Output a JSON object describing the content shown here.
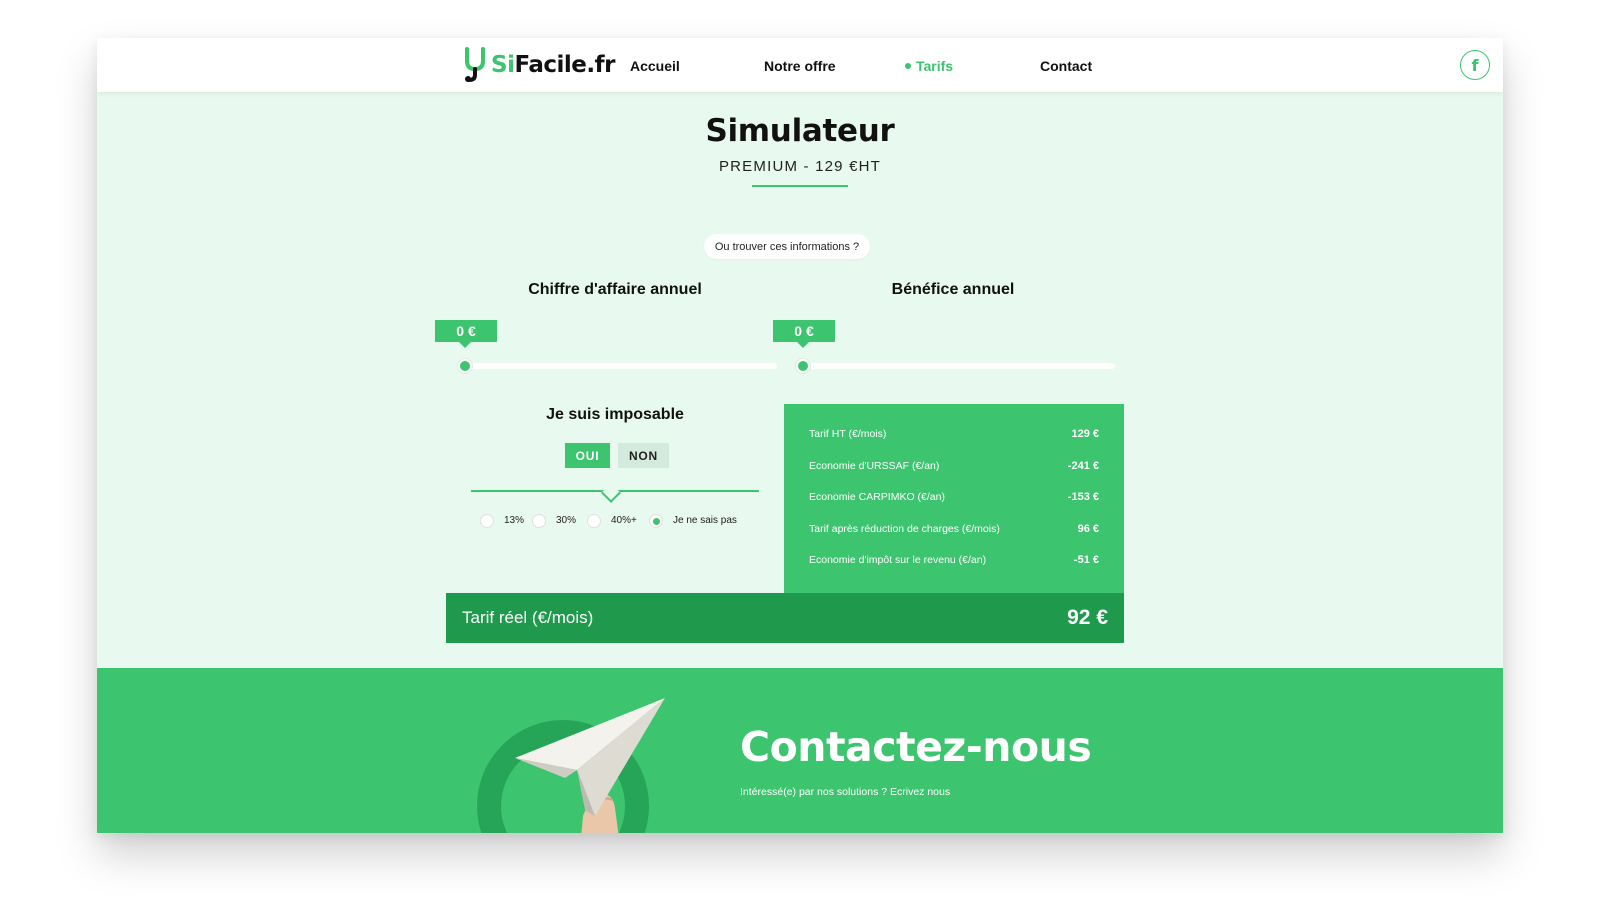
{
  "brand": {
    "logo_si": "Si",
    "logo_rest": "Facile.fr",
    "primary_color": "#3cc46f",
    "dark_green": "#1f9a4d",
    "background_tint": "#e8f9ef"
  },
  "nav": {
    "items": [
      {
        "label": "Accueil",
        "active": false
      },
      {
        "label": "Notre offre",
        "active": false
      },
      {
        "label": "Tarifs",
        "active": true
      },
      {
        "label": "Contact",
        "active": false
      }
    ],
    "social_icon": "facebook-icon",
    "social_glyph": "f"
  },
  "simulator": {
    "title": "Simulateur",
    "subtitle": "PREMIUM - 129 €HT",
    "info_link": "Ou trouver ces informations ?",
    "sliders": [
      {
        "label": "Chiffre d'affaire annuel",
        "value": "0 €",
        "level": 0
      },
      {
        "label": "Bénéfice annuel",
        "value": "0 €",
        "level": 0
      }
    ]
  },
  "imposable": {
    "title": "Je suis imposable",
    "options": [
      {
        "label": "OUI",
        "selected": true
      },
      {
        "label": "NON",
        "selected": false
      }
    ],
    "rates": [
      {
        "label": "13%",
        "checked": false
      },
      {
        "label": "30%",
        "checked": false
      },
      {
        "label": "40%+",
        "checked": false
      },
      {
        "label": "Je ne sais pas",
        "checked": true
      }
    ]
  },
  "results": {
    "rows": [
      {
        "label": "Tarif HT (€/mois)",
        "value": "129 €"
      },
      {
        "label": "Economie d'URSSAF (€/an)",
        "value": "-241 €"
      },
      {
        "label": "Economie CARPIMKO (€/an)",
        "value": "-153 €"
      },
      {
        "label": "Tarif après réduction de charges (€/mois)",
        "value": "96 €"
      },
      {
        "label": "Economie d'impôt sur le revenu (€/an)",
        "value": "-51 €"
      }
    ],
    "total_label": "Tarif réel (€/mois)",
    "total_value": "92 €"
  },
  "contact": {
    "title": "Contactez-nous",
    "subtitle": "Intéressé(e) par nos solutions ? Ecrivez nous",
    "illustration": "paper-plane-illustration"
  }
}
